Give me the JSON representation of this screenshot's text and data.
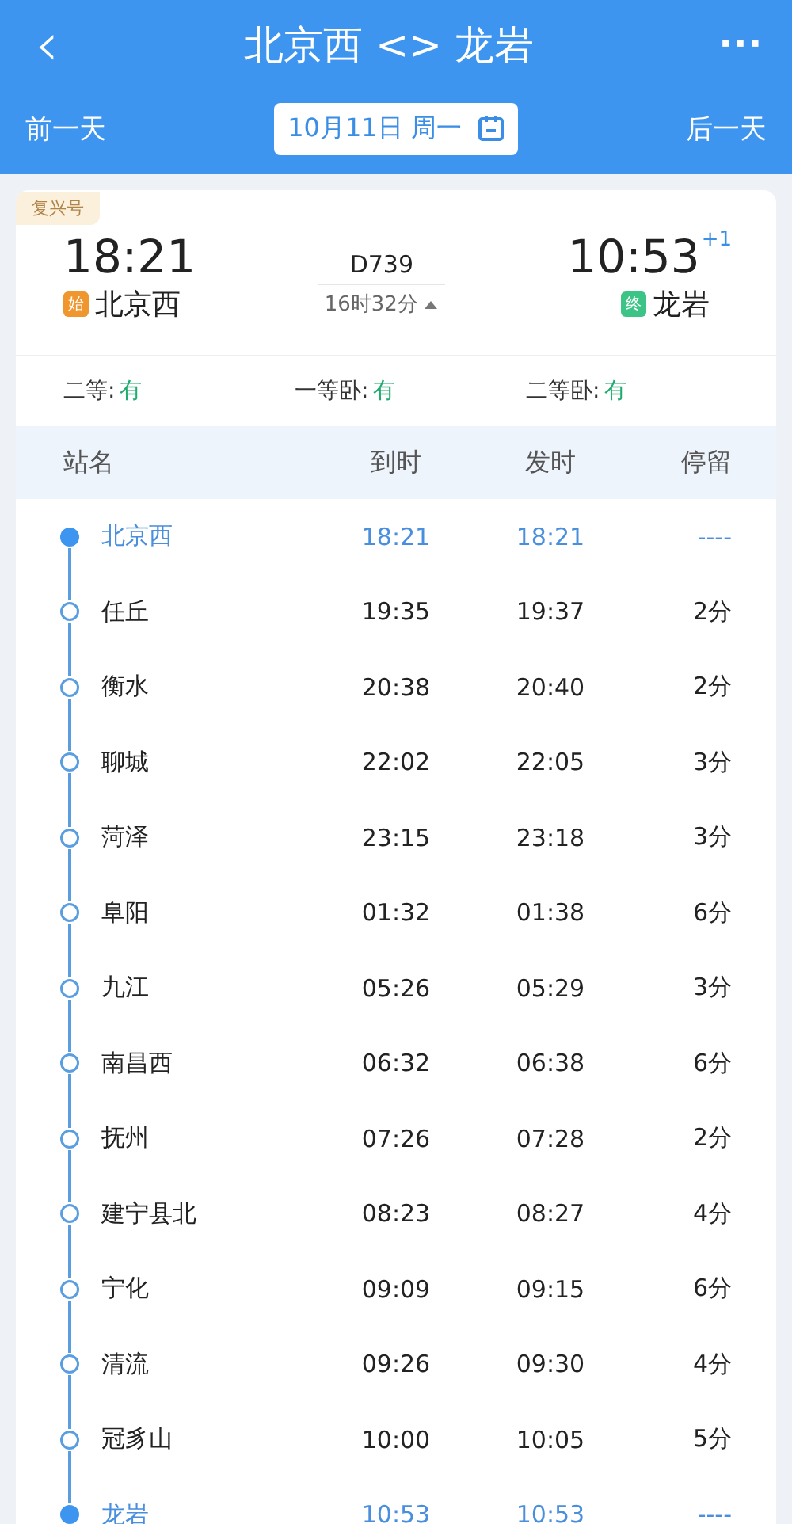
{
  "header": {
    "back": "‹",
    "title": "北京西 <> 龙岩",
    "more": "···",
    "prev_day": "前一天",
    "date": "10月11日 周一",
    "next_day": "后一天"
  },
  "train": {
    "type_badge": "复兴号",
    "depart_time": "18:21",
    "depart_tag": "始",
    "depart_station": "北京西",
    "number": "D739",
    "duration": "16时32分",
    "expanded": true,
    "arrive_time": "10:53",
    "day_offset": "+1",
    "arrive_tag": "终",
    "arrive_station": "龙岩"
  },
  "seats": [
    {
      "class": "二等:",
      "availability": "有"
    },
    {
      "class": "一等卧:",
      "availability": "有"
    },
    {
      "class": "二等卧:",
      "availability": "有"
    }
  ],
  "table": {
    "columns": [
      "站名",
      "到时",
      "发时",
      "停留"
    ],
    "rows": [
      {
        "kind": "endpoint",
        "station": "北京西",
        "arrive": "18:21",
        "depart": "18:21",
        "stop": "----"
      },
      {
        "kind": "stop",
        "station": "任丘",
        "arrive": "19:35",
        "depart": "19:37",
        "stop": "2分"
      },
      {
        "kind": "stop",
        "station": "衡水",
        "arrive": "20:38",
        "depart": "20:40",
        "stop": "2分"
      },
      {
        "kind": "stop",
        "station": "聊城",
        "arrive": "22:02",
        "depart": "22:05",
        "stop": "3分"
      },
      {
        "kind": "stop",
        "station": "菏泽",
        "arrive": "23:15",
        "depart": "23:18",
        "stop": "3分"
      },
      {
        "kind": "stop",
        "station": "阜阳",
        "arrive": "01:32",
        "depart": "01:38",
        "stop": "6分"
      },
      {
        "kind": "stop",
        "station": "九江",
        "arrive": "05:26",
        "depart": "05:29",
        "stop": "3分"
      },
      {
        "kind": "stop",
        "station": "南昌西",
        "arrive": "06:32",
        "depart": "06:38",
        "stop": "6分"
      },
      {
        "kind": "stop",
        "station": "抚州",
        "arrive": "07:26",
        "depart": "07:28",
        "stop": "2分"
      },
      {
        "kind": "stop",
        "station": "建宁县北",
        "arrive": "08:23",
        "depart": "08:27",
        "stop": "4分"
      },
      {
        "kind": "stop",
        "station": "宁化",
        "arrive": "09:09",
        "depart": "09:15",
        "stop": "6分"
      },
      {
        "kind": "stop",
        "station": "清流",
        "arrive": "09:26",
        "depart": "09:30",
        "stop": "4分"
      },
      {
        "kind": "stop",
        "station": "冠豸山",
        "arrive": "10:00",
        "depart": "10:05",
        "stop": "5分"
      },
      {
        "kind": "endpoint",
        "station": "龙岩",
        "arrive": "10:53",
        "depart": "10:53",
        "stop": "----"
      }
    ]
  }
}
